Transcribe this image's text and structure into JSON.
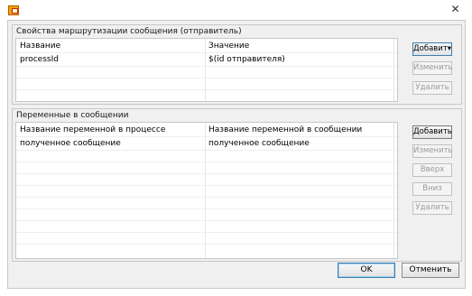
{
  "window": {
    "close_glyph": "✕"
  },
  "routing": {
    "title": "Свойства маршрутизации сообщения (отправитель)",
    "col_name": "Название",
    "col_value": "Значение",
    "rows": [
      {
        "name": "processId",
        "value": "$(id отправителя)"
      }
    ],
    "buttons": {
      "add": "Добавит▾",
      "edit": "Изменить",
      "delete": "Удалить"
    }
  },
  "variables": {
    "title": "Переменные в сообщении",
    "col_process": "Название переменной в процессе",
    "col_message": "Название переменной в сообщении",
    "rows": [
      {
        "process_var": "полученное сообщение",
        "message_var": "полученное сообщение"
      }
    ],
    "buttons": {
      "add": "Добавить",
      "edit": "Изменить",
      "up": "Вверх",
      "down": "Вниз",
      "delete": "Удалить"
    }
  },
  "footer": {
    "ok": "OK",
    "cancel": "Отменить"
  }
}
